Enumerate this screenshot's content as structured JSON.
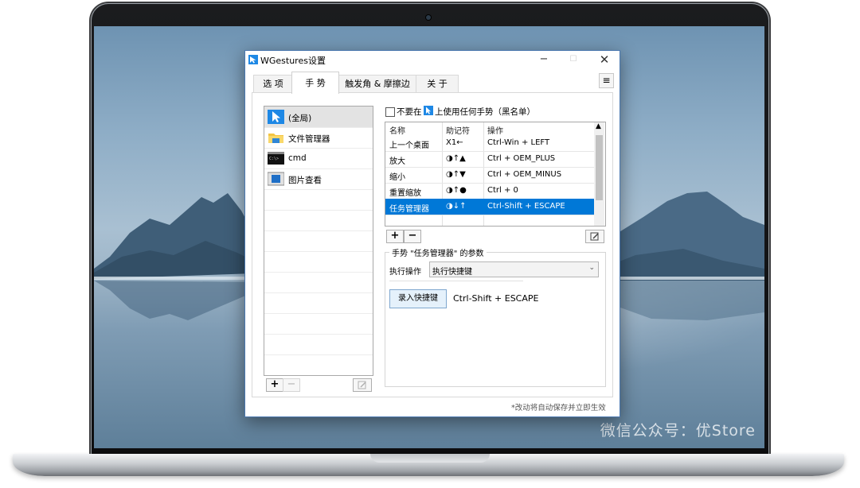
{
  "window": {
    "title": "WGestures设置"
  },
  "title_buttons": {
    "minimize": "−",
    "maximize": "☐",
    "close": "✕"
  },
  "tabs": [
    "选 项",
    "手 势",
    "触发角 & 摩擦边",
    "关 于"
  ],
  "menu_button": "≡",
  "apps": [
    {
      "label": "(全局)",
      "icon": "pointer-icon",
      "selected": true
    },
    {
      "label": "文件管理器",
      "icon": "folder-icon",
      "selected": false
    },
    {
      "label": "cmd",
      "icon": "terminal-icon",
      "selected": false
    },
    {
      "label": "图片查看",
      "icon": "image-viewer-icon",
      "selected": false
    }
  ],
  "app_buttons": {
    "add": "+",
    "remove": "−"
  },
  "blacklist": {
    "prefix": "不要在",
    "suffix": "上使用任何手势（黑名单）",
    "checked": false
  },
  "gesture_table": {
    "headers": [
      "名称",
      "助记符",
      "操作"
    ],
    "rows": [
      {
        "name": "上一个桌面",
        "mnemonic": "X1←",
        "action": "Ctrl-Win + LEFT",
        "selected": false
      },
      {
        "name": "放大",
        "mnemonic": "◑↑▲",
        "action": "Ctrl + OEM_PLUS",
        "selected": false
      },
      {
        "name": "缩小",
        "mnemonic": "◑↑▼",
        "action": "Ctrl + OEM_MINUS",
        "selected": false
      },
      {
        "name": "重置缩放",
        "mnemonic": "◑↑●",
        "action": "Ctrl + 0",
        "selected": false
      },
      {
        "name": "任务管理器",
        "mnemonic": "◑↓↑",
        "action": "Ctrl-Shift + ESCAPE",
        "selected": true
      }
    ]
  },
  "gesture_buttons": {
    "add": "+",
    "remove": "−"
  },
  "params": {
    "legend": "手势 \"任务管理器\" 的参数",
    "action_label": "执行操作",
    "action_value": "执行快捷键",
    "record_button": "录入快捷键",
    "hotkey": "Ctrl-Shift + ESCAPE"
  },
  "footer_note": "*改动将自动保存并立即生效",
  "watermark": "微信公众号：优Store",
  "colors": {
    "accent": "#0078d7",
    "window_border": "#4a78b0"
  }
}
